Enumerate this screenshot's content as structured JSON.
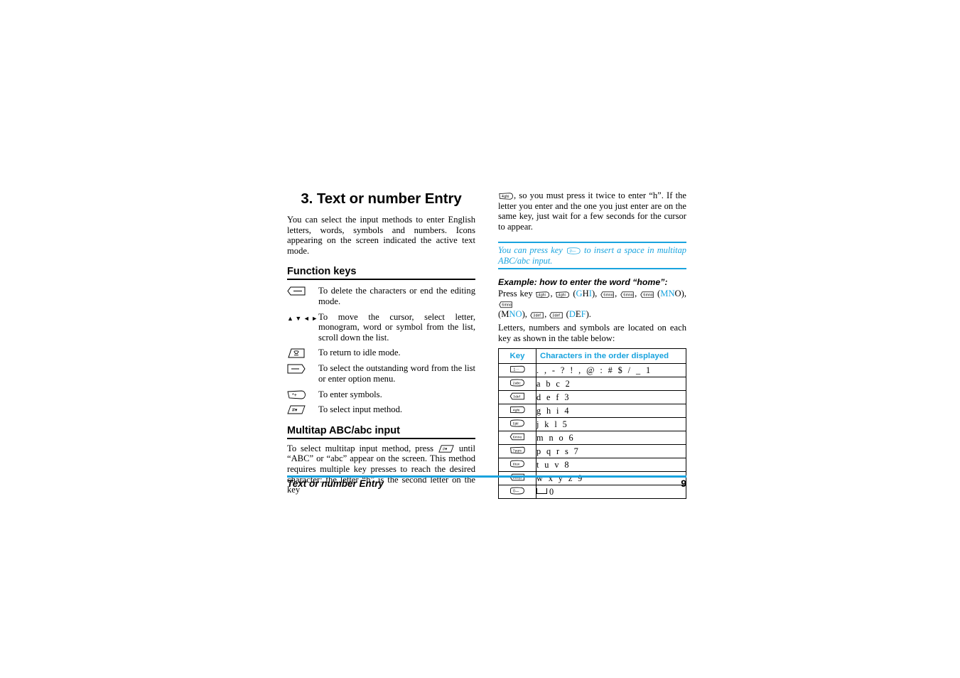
{
  "document": {
    "chapter_title": "3. Text or number Entry",
    "intro": "You can select the input methods to enter English letters, words, symbols and numbers. Icons appearing on the screen indicated the active text mode."
  },
  "function_keys": {
    "heading": "Function keys",
    "items": [
      {
        "icon": "clear-key-icon",
        "text": "To delete the characters or end the editing mode."
      },
      {
        "icon": "navigation-arrows-icon",
        "text": "To move the cursor, select letter, monogram, word or symbol from the list, scroll down the list."
      },
      {
        "icon": "hangup-key-icon",
        "text": "To return to idle mode."
      },
      {
        "icon": "softkey-icon",
        "text": "To select the outstanding word from the list or enter option menu."
      },
      {
        "icon": "star-key-icon",
        "text": "To enter symbols."
      },
      {
        "icon": "hash-key-icon",
        "text": "To select input method."
      }
    ]
  },
  "multitap": {
    "heading": "Multitap ABC/abc input",
    "paragraph_part1": "To select multitap input method, press ",
    "paragraph_part2": " until “ABC” or “abc” appear on the screen. This method requires multiple key presses to reach the desired character: the letter “h” is the second letter on the key"
  },
  "right_column": {
    "continued_part1": ", so you must press it twice to enter “h”. If the letter you enter and the one you just enter are on the same key, just wait for a few seconds for the cursor to appear.",
    "note_part1": "You can press key ",
    "note_part2": " to insert a space in multitap ABC/abc input."
  },
  "example": {
    "heading": "Example: how to enter the word “home”:",
    "press_label": "Press key ",
    "sequence": [
      {
        "type": "key",
        "label": "4"
      },
      {
        "type": "sep",
        "text": ", "
      },
      {
        "type": "key",
        "label": "4"
      },
      {
        "type": "sep",
        "text": " "
      },
      {
        "type": "group",
        "plain_before": "(",
        "hl": "G",
        "plain_mid": "H",
        "hl2": "I",
        "plain_after": ") "
      },
      {
        "type": "key",
        "label": "6"
      },
      {
        "type": "sep",
        "text": ", "
      },
      {
        "type": "key",
        "label": "6"
      },
      {
        "type": "sep",
        "text": ", "
      },
      {
        "type": "key",
        "label": "6"
      },
      {
        "type": "sep",
        "text": " "
      },
      {
        "type": "group2",
        "text": "(MNO), "
      },
      {
        "type": "key",
        "label": "6"
      },
      {
        "type": "sep",
        "text": " "
      },
      {
        "type": "group3",
        "text": "(MNO), "
      },
      {
        "type": "key",
        "label": "3"
      },
      {
        "type": "sep",
        "text": ", "
      },
      {
        "type": "key",
        "label": "3"
      },
      {
        "type": "sep",
        "text": " "
      },
      {
        "type": "group4",
        "text": "(DEF)."
      }
    ],
    "groups": {
      "ghi_open": "(",
      "ghi_g": "G",
      "ghi_h": "H",
      "ghi_i": "I",
      "ghi_close": "), ",
      "mno1_open": "(",
      "mno1_m": "M",
      "mno1_n": "N",
      "mno1_o": "O",
      "mno1_close": "), ",
      "mno2_open": "(M",
      "mno2_no": "NO",
      "mno2_close": "), ",
      "def_open": "(",
      "def_d": "D",
      "def_e": "E",
      "def_f": "F",
      "def_close": ")."
    },
    "trailing": "Letters, numbers and symbols are located on each key as shown in the table below:"
  },
  "key_table": {
    "headers": {
      "key": "Key",
      "chars": "Characters in the order displayed"
    },
    "rows": [
      {
        "key": "1",
        "key_sub": "1₀₀",
        "chars": ". , - ? !  ,  @  :  #  $  /  _  1",
        "is_space_row": false
      },
      {
        "key": "2",
        "key_sub": "2abc",
        "chars": "a  b  c  2",
        "is_space_row": false
      },
      {
        "key": "3",
        "key_sub": "3def",
        "chars": "d  e  f  3",
        "is_space_row": false
      },
      {
        "key": "4",
        "key_sub": "4ghi",
        "chars": "g  h  i  4",
        "is_space_row": false
      },
      {
        "key": "5",
        "key_sub": "5jkl",
        "chars": "j  k  l  5",
        "is_space_row": false
      },
      {
        "key": "6",
        "key_sub": "6mno",
        "chars": "m  n  o  6",
        "is_space_row": false
      },
      {
        "key": "7",
        "key_sub": "7pqrs",
        "chars": "p  q  r  s  7",
        "is_space_row": false
      },
      {
        "key": "8",
        "key_sub": "8tuv",
        "chars": "t  u  v  8",
        "is_space_row": false
      },
      {
        "key": "9",
        "key_sub": "9wxyz",
        "chars": "w  x  y  z  9",
        "is_space_row": false
      },
      {
        "key": "0",
        "key_sub": "0␣",
        "chars": "0",
        "is_space_row": true
      }
    ]
  },
  "footer": {
    "running_head": "Text or number Entry",
    "page_number": "9"
  },
  "colors": {
    "accent": "#19A3DE",
    "text": "#000000",
    "rule": "#000000"
  }
}
